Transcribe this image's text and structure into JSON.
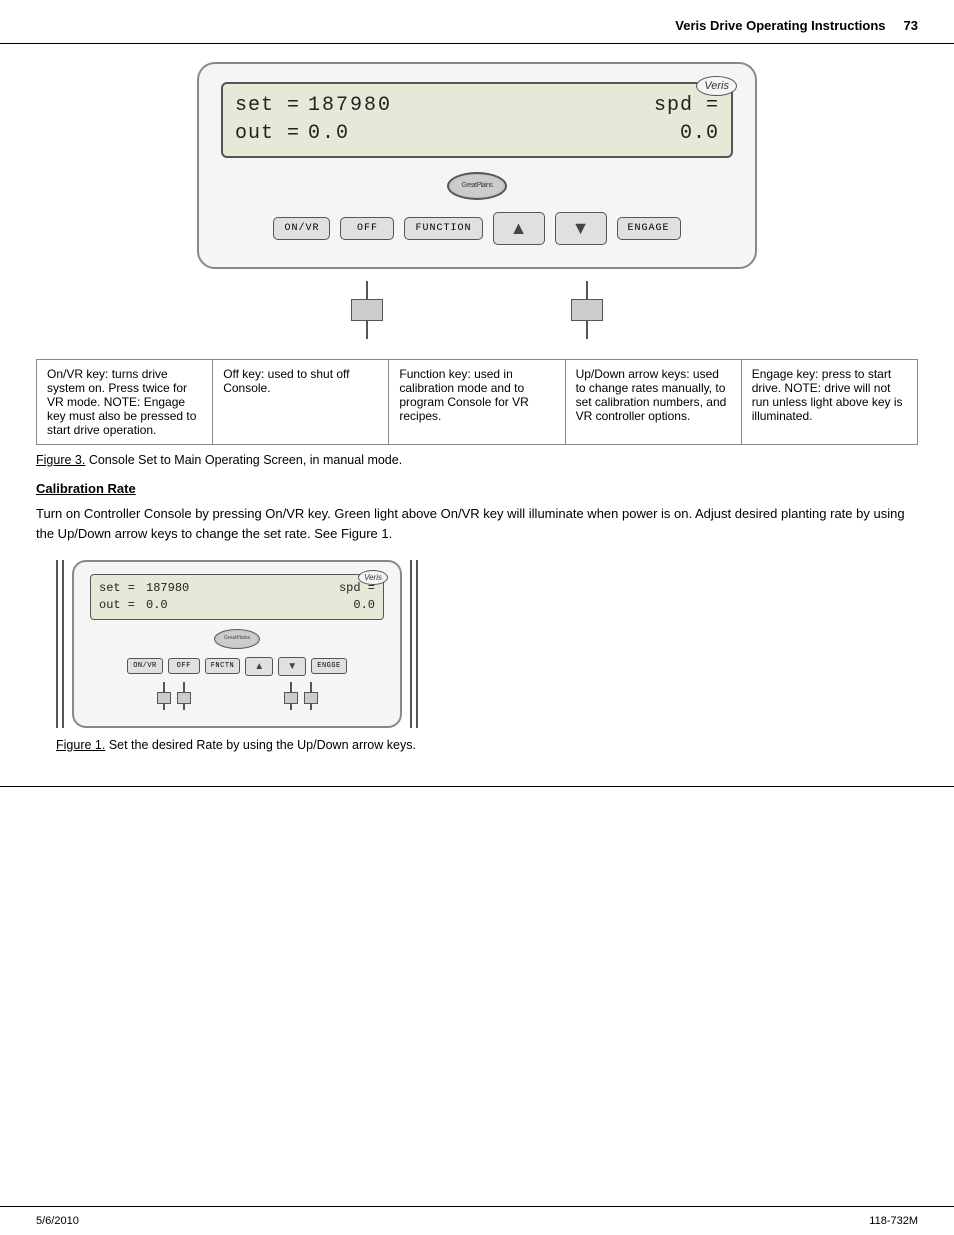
{
  "header": {
    "title": "Veris Drive Operating Instructions",
    "page_number": "73"
  },
  "figure1": {
    "veris_label": "Veris",
    "lcd": {
      "row1_label": "set =",
      "row1_value": "187980",
      "row1_right_label": "spd =",
      "row2_label": "out =",
      "row2_value": "0.0",
      "row2_right_value": "0.0"
    },
    "knob_label": "GreatPlains",
    "buttons": [
      {
        "id": "on-vr",
        "label": "ON/VR"
      },
      {
        "id": "off",
        "label": "OFF"
      },
      {
        "id": "function",
        "label": "FUNCTION"
      },
      {
        "id": "up-arrow",
        "label": "▲",
        "type": "arrow"
      },
      {
        "id": "down-arrow",
        "label": "▼",
        "type": "arrow"
      },
      {
        "id": "engage",
        "label": "ENGAGE"
      }
    ],
    "table": [
      {
        "col": 1,
        "text": "On/VR key: turns drive system on. Press twice for VR mode. NOTE: Engage key must also be pressed to start drive operation."
      },
      {
        "col": 2,
        "text": "Off key: used to shut off Console."
      },
      {
        "col": 3,
        "text": "Function key: used in calibration mode and to program Console for VR recipes."
      },
      {
        "col": 4,
        "text": "Up/Down arrow keys: used to change rates manually, to set calibration numbers, and VR controller options."
      },
      {
        "col": 5,
        "text": "Engage key: press to start drive. NOTE: drive will not run unless light above key is illuminated."
      }
    ],
    "caption_prefix": "Figure 3.",
    "caption_text": " Console Set to Main Operating Screen, in manual mode."
  },
  "calibration": {
    "heading": "Calibration Rate",
    "body": "Turn on Controller Console by pressing On/VR key. Green light above On/VR key will illuminate when power is on. Adjust desired planting rate by using the Up/Down arrow keys to change the set rate. See Figure 1."
  },
  "figure2": {
    "veris_label": "Veris",
    "lcd": {
      "row1_label": "set =",
      "row1_value": "187980",
      "row1_right_label": "spd =",
      "row2_label": "out =",
      "row2_value": "0.0",
      "row2_right_value": "0.0"
    },
    "knob_label": "GreatPlains",
    "buttons": [
      {
        "id": "on-vr-s",
        "label": "ON/VR"
      },
      {
        "id": "off-s",
        "label": "OFF"
      },
      {
        "id": "function-s",
        "label": "FNCTN"
      },
      {
        "id": "up-arrow-s",
        "label": "▲",
        "type": "arrow"
      },
      {
        "id": "down-arrow-s",
        "label": "▼",
        "type": "arrow"
      },
      {
        "id": "engage-s",
        "label": "ENGGE"
      }
    ],
    "caption_prefix": "Figure 1.",
    "caption_text": " Set the desired Rate by using the Up/Down arrow keys."
  },
  "footer": {
    "left": "5/6/2010",
    "right": "118-732M"
  }
}
